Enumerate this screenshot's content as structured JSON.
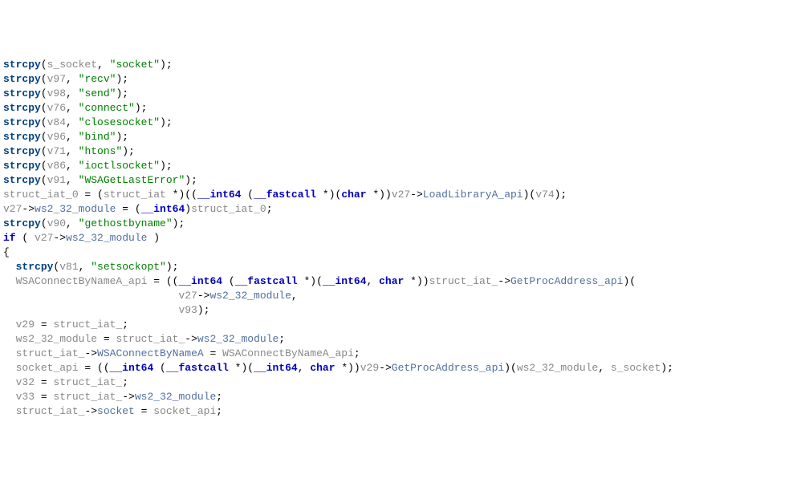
{
  "code": {
    "l1": {
      "fn": "strcpy",
      "a1": "s_socket",
      "s": "\"socket\""
    },
    "l2": {
      "fn": "strcpy",
      "a1": "v97",
      "s": "\"recv\""
    },
    "l3": {
      "fn": "strcpy",
      "a1": "v98",
      "s": "\"send\""
    },
    "l4": {
      "fn": "strcpy",
      "a1": "v76",
      "s": "\"connect\""
    },
    "l5": {
      "fn": "strcpy",
      "a1": "v84",
      "s": "\"closesocket\""
    },
    "l6": {
      "fn": "strcpy",
      "a1": "v96",
      "s": "\"bind\""
    },
    "l7": {
      "fn": "strcpy",
      "a1": "v71",
      "s": "\"htons\""
    },
    "l8": {
      "fn": "strcpy",
      "a1": "v86",
      "s": "\"ioctlsocket\""
    },
    "l9": {
      "fn": "strcpy",
      "a1": "v91",
      "s": "\"WSAGetLastError\""
    },
    "l10": {
      "lhs": "struct_iat_0",
      "t1": "struct_iat",
      "t2": "__int64",
      "t3": "__fastcall",
      "t4": "char",
      "obj": "v27",
      "mem": "LoadLibraryA_api",
      "arg": "v74"
    },
    "l11": {
      "obj": "v27",
      "mem": "ws2_32_module",
      "t": "__int64",
      "rhs": "struct_iat_0"
    },
    "l12": {
      "fn": "strcpy",
      "a1": "v90",
      "s": "\"gethostbyname\""
    },
    "l13": {
      "kw": "if",
      "obj": "v27",
      "mem": "ws2_32_module"
    },
    "l14": {
      "brace": "{"
    },
    "l15": {
      "fn": "strcpy",
      "a1": "v81",
      "s": "\"setsockopt\""
    },
    "l16": {
      "lhs": "WSAConnectByNameA_api",
      "t2": "__int64",
      "t3": "__fastcall",
      "t4": "__int64",
      "t5": "char",
      "obj": "struct_iat_",
      "mem": "GetProcAddress_api"
    },
    "l17": {
      "obj": "v27",
      "mem": "ws2_32_module"
    },
    "l18": {
      "arg": "v93"
    },
    "l19": {
      "lhs": "v29",
      "rhs": "struct_iat_"
    },
    "l20": {
      "lhs": "ws2_32_module",
      "obj": "struct_iat_",
      "mem": "ws2_32_module"
    },
    "l21": {
      "obj": "struct_iat_",
      "mem": "WSAConnectByNameA",
      "rhs": "WSAConnectByNameA_api"
    },
    "l22": {
      "lhs": "socket_api",
      "t2": "__int64",
      "t3": "__fastcall",
      "t4": "__int64",
      "t5": "char",
      "obj": "v29",
      "mem": "GetProcAddress_api",
      "a1": "ws2_32_module",
      "a2": "s_socket"
    },
    "l23": {
      "lhs": "v32",
      "rhs": "struct_iat_"
    },
    "l24": {
      "lhs": "v33",
      "obj": "struct_iat_",
      "mem": "ws2_32_module"
    },
    "l25": {
      "obj": "struct_iat_",
      "mem": "socket",
      "rhs": "socket_api"
    }
  }
}
